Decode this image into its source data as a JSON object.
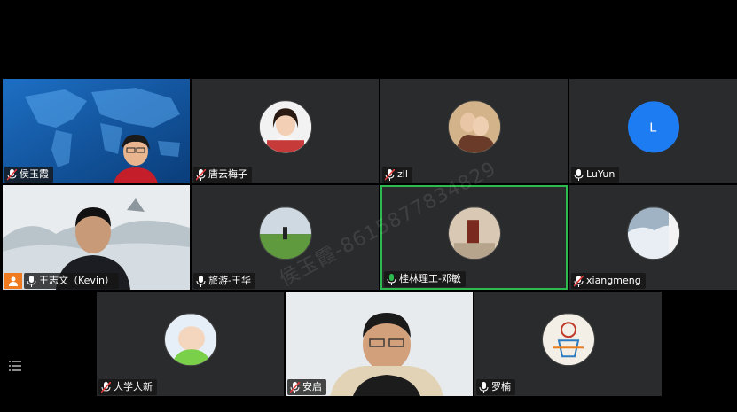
{
  "participants": [
    {
      "name": "侯玉霞",
      "muted": true
    },
    {
      "name": "唐云梅子",
      "muted": true
    },
    {
      "name": "zll",
      "muted": true
    },
    {
      "name": "LuYun",
      "muted": false,
      "initial": "L"
    },
    {
      "name": "王志文（Kevin）",
      "muted": false
    },
    {
      "name": "旅游-王华",
      "muted": false
    },
    {
      "name": "桂林理工-邓敏",
      "muted": false,
      "speaking": true
    },
    {
      "name": "xiangmeng",
      "muted": true
    },
    {
      "name": "大学大新",
      "muted": true
    },
    {
      "name": "安启",
      "muted": true
    },
    {
      "name": "罗楠",
      "muted": false
    }
  ],
  "watermark": "侯玉霞-8615877834829",
  "colors": {
    "active_border": "#2dba4e",
    "tile_bg": "#2a2b2d",
    "avatar_blue": "#1e7cf2",
    "mic_on": "#ffffff",
    "mic_muted": "#e03a3a",
    "speaking_mic": "#2dba4e"
  }
}
